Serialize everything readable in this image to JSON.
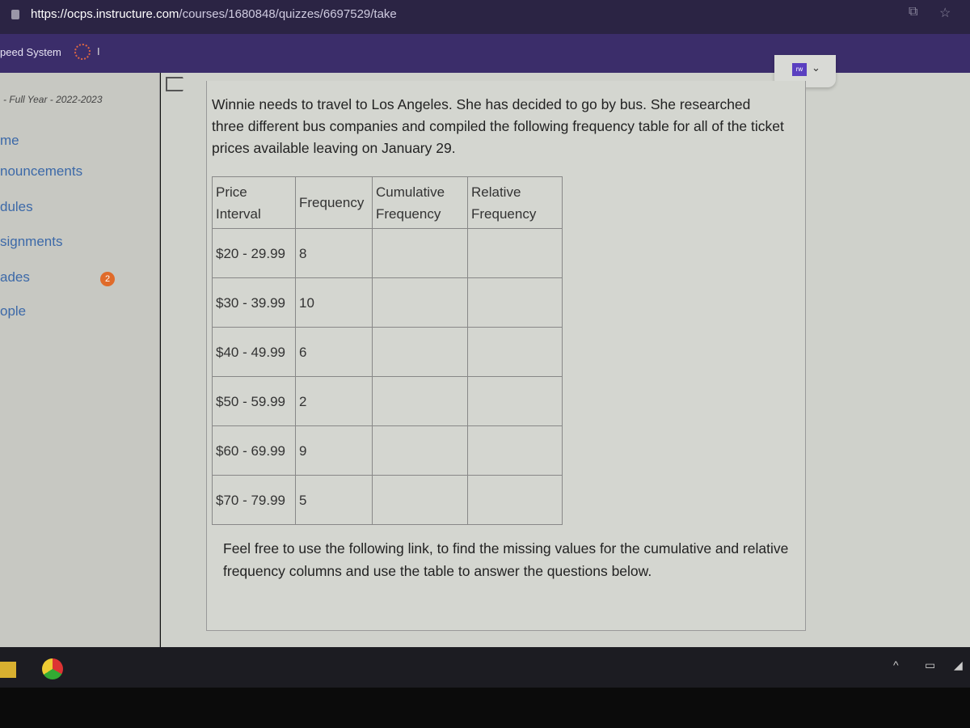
{
  "browser": {
    "url_host": "https://ocps.instructure.com",
    "url_path": "/courses/1680848/quizzes/6697529/take",
    "bookmark": "peed System",
    "bookmark_sep": "I"
  },
  "sidebar": {
    "term": "- Full Year - 2022-2023",
    "items": [
      {
        "label": "me"
      },
      {
        "label": "nouncements"
      },
      {
        "label": "dules"
      },
      {
        "label": "signments"
      },
      {
        "label": "ades",
        "badge": "2"
      },
      {
        "label": "ople"
      }
    ]
  },
  "extension": {
    "label": "rw"
  },
  "question": {
    "intro": "Winnie needs to travel to Los Angeles. She has decided to go by bus. She researched three different bus companies and compiled the following frequency table for all of the ticket prices available leaving on January 29.",
    "table": {
      "headers": [
        "Price Interval",
        "Frequency",
        "Cumulative Frequency",
        "Relative Frequency"
      ],
      "rows": [
        {
          "interval": "$20 - 29.99",
          "frequency": "8",
          "cumulative": "",
          "relative": ""
        },
        {
          "interval": "$30 - 39.99",
          "frequency": "10",
          "cumulative": "",
          "relative": ""
        },
        {
          "interval": "$40 - 49.99",
          "frequency": "6",
          "cumulative": "",
          "relative": ""
        },
        {
          "interval": "$50 - 59.99",
          "frequency": "2",
          "cumulative": "",
          "relative": ""
        },
        {
          "interval": "$60 - 69.99",
          "frequency": "9",
          "cumulative": "",
          "relative": ""
        },
        {
          "interval": "$70 - 79.99",
          "frequency": "5",
          "cumulative": "",
          "relative": ""
        }
      ]
    },
    "after": "Feel free to use the following link, to find the missing values for the cumulative and relative frequency columns and use the table to answer the questions below."
  }
}
